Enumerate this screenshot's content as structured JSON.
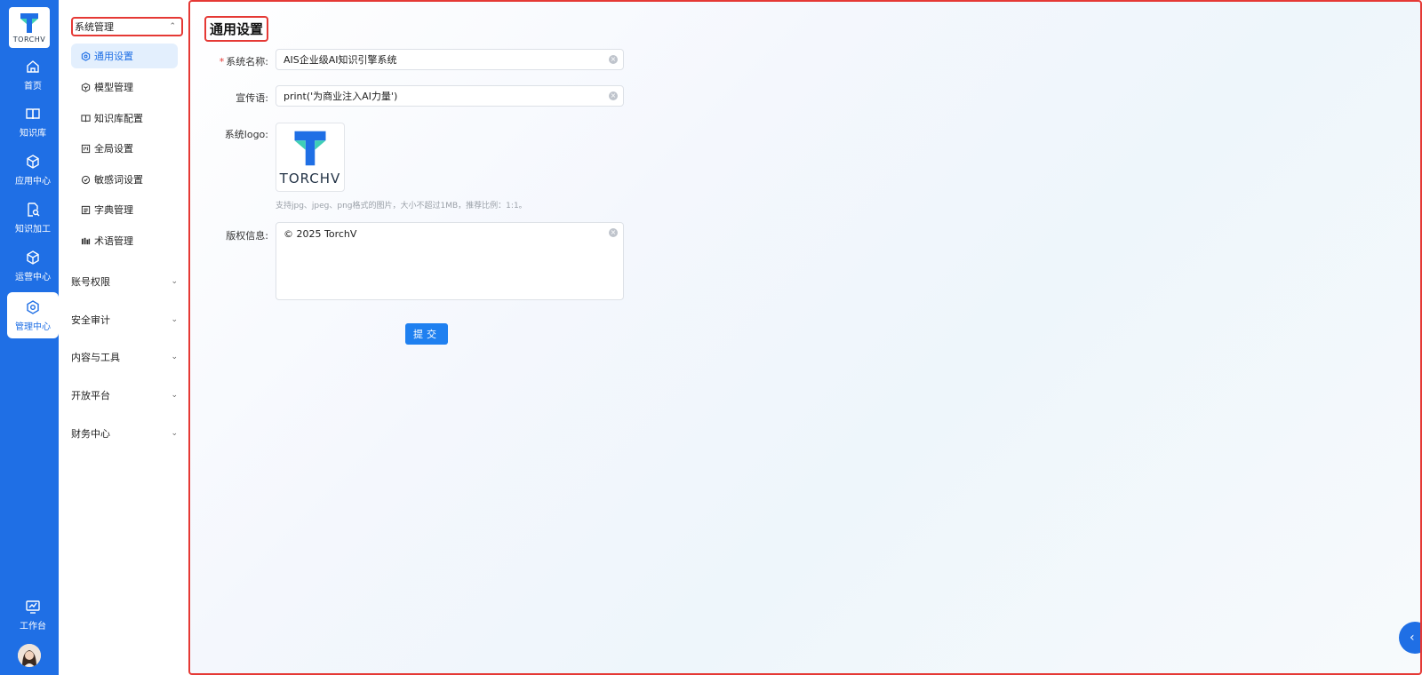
{
  "brand": {
    "logo_text": "TORCHV",
    "accent": "#1f6fe5"
  },
  "rail": {
    "items": [
      {
        "label": "首页",
        "icon": "home-icon"
      },
      {
        "label": "知识库",
        "icon": "book-icon"
      },
      {
        "label": "应用中心",
        "icon": "cube-icon"
      },
      {
        "label": "知识加工",
        "icon": "doc-search-icon"
      },
      {
        "label": "运营中心",
        "icon": "cube-icon"
      },
      {
        "label": "管理中心",
        "icon": "gear-icon"
      }
    ],
    "workbench": {
      "label": "工作台",
      "icon": "monitor-chart-icon"
    }
  },
  "sidebar": {
    "system_group": "系统管理",
    "system_items": [
      {
        "label": "通用设置",
        "icon": "gear-icon"
      },
      {
        "label": "模型管理",
        "icon": "model-icon"
      },
      {
        "label": "知识库配置",
        "icon": "book-icon"
      },
      {
        "label": "全局设置",
        "icon": "grid-icon"
      },
      {
        "label": "敏感词设置",
        "icon": "shield-icon"
      },
      {
        "label": "字典管理",
        "icon": "list-icon"
      },
      {
        "label": "术语管理",
        "icon": "bars-icon"
      }
    ],
    "groups": [
      "账号权限",
      "安全审计",
      "内容与工具",
      "开放平台",
      "财务中心"
    ]
  },
  "main": {
    "title": "通用设置",
    "form": {
      "system_name_label": "系统名称:",
      "system_name_value": "AIS企业级AI知识引擎系统",
      "slogan_label": "宣传语:",
      "slogan_value": "print('为商业注入AI力量')",
      "logo_label": "系统logo:",
      "logo_text": "TORCHV",
      "logo_hint": "支持jpg、jpeg、png格式的图片，大小不超过1MB，推荐比例：1:1。",
      "copyright_label": "版权信息:",
      "copyright_value": "© 2025 TorchV",
      "submit_label": "提交"
    }
  }
}
